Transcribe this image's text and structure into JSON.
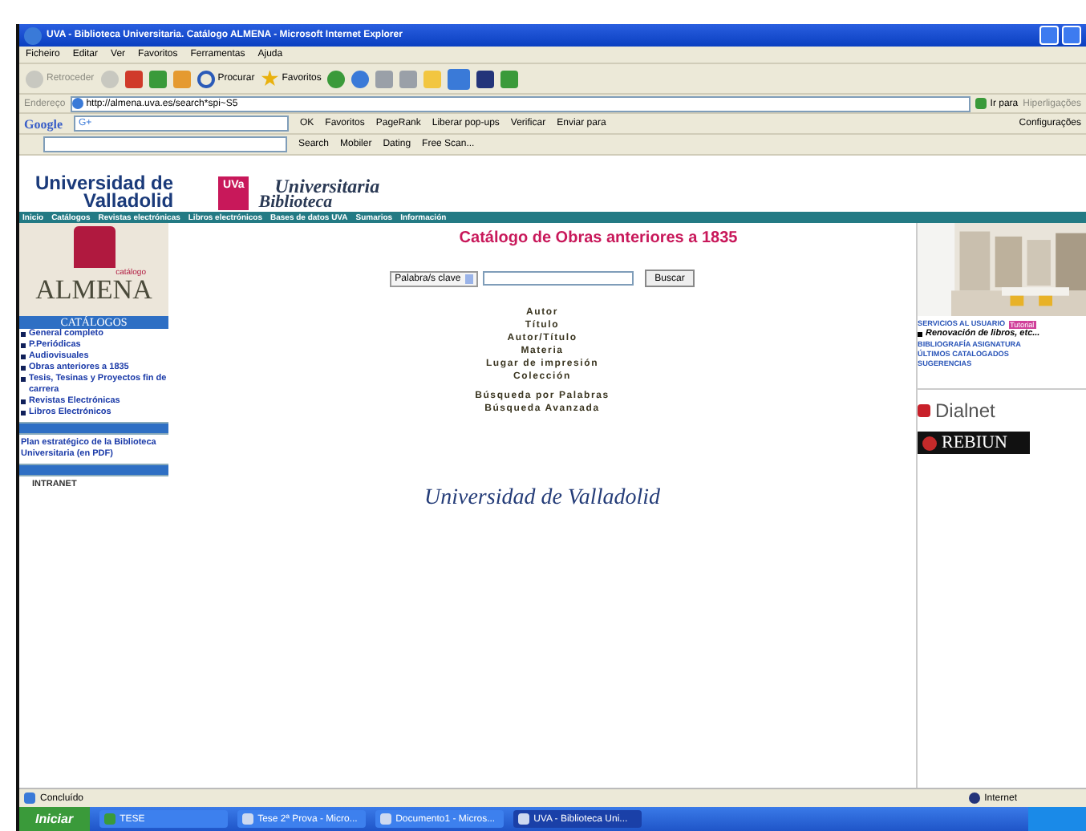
{
  "window": {
    "title": "UVA - Biblioteca Universitaria. Catálogo ALMENA - Microsoft Internet Explorer"
  },
  "menu": [
    "Ficheiro",
    "Editar",
    "Ver",
    "Favoritos",
    "Ferramentas",
    "Ajuda"
  ],
  "toolbar": [
    {
      "label": "Retroceder"
    },
    {
      "label": "Procurar"
    },
    {
      "label": "Favoritos"
    }
  ],
  "address": {
    "label": "Endereço",
    "value": "http://almena.uva.es/search*spi~S5",
    "go": "Ir para",
    "links": "Hiperligações"
  },
  "google_bar": {
    "logo": "Google",
    "field": "G+",
    "items": [
      "OK",
      "Favoritos",
      "PageRank",
      "Liberar pop-ups",
      "Verificar",
      "Enviar para"
    ],
    "settings": "Configurações"
  },
  "second_bar": {
    "items": [
      "Search",
      "Mobiler",
      "Dating",
      "Free Scan..."
    ]
  },
  "site": {
    "brand_top": "Universidad de",
    "brand_bottom": "Valladolid",
    "badge": "UVa",
    "library_top": "Universitaria",
    "library_bottom": "Biblioteca",
    "nav": [
      "Inicio",
      "Catálogos",
      "Revistas electrónicas",
      "Libros electrónicos",
      "Bases de datos UVA",
      "Sumarios",
      "Información"
    ]
  },
  "sidebar": {
    "logo_caption": "catálogo",
    "logo": "ALMENA",
    "heading": "CATÁLOGOS",
    "items": [
      "General completo",
      "P.Periódicas",
      "Audiovisuales",
      "Obras anteriores a 1835",
      "Tesis, Tesinas y Proyectos fin de carrera",
      "Revistas Electrónicas",
      "Libros Electrónicos"
    ],
    "plan": "Plan estratégico de la Biblioteca Universitaria (en PDF)",
    "intranet": "INTRANET"
  },
  "main": {
    "title": "Catálogo de Obras anteriores a 1835",
    "select": "Palabra/s clave",
    "button": "Buscar",
    "links": [
      "Autor",
      "Título",
      "Autor/Título",
      "Materia",
      "Lugar de impresión",
      "Colección"
    ],
    "links2": [
      "Búsqueda por Palabras",
      "Búsqueda Avanzada"
    ],
    "signature": "Universidad de Valladolid"
  },
  "right": {
    "services": "SERVICIOS AL USUARIO",
    "badge": "Tutorial",
    "renew": "Renovación de libros, etc...",
    "links": [
      "BIBLIOGRAFÍA ASIGNATURA",
      "ÚLTIMOS CATALOGADOS",
      "SUGERENCIAS"
    ],
    "dialnet": "Dialnet",
    "rebiun": "REBIUN"
  },
  "status_bar": {
    "text": "Concluído",
    "zone": "Internet"
  },
  "taskbar": {
    "start": "Iniciar",
    "tasks": [
      {
        "label": "TESE",
        "selected": false
      },
      {
        "label": "Tese 2ª Prova - Micro...",
        "selected": false
      },
      {
        "label": "Documento1 - Micros...",
        "selected": false
      },
      {
        "label": "UVA - Biblioteca Uni...",
        "selected": true
      }
    ]
  }
}
